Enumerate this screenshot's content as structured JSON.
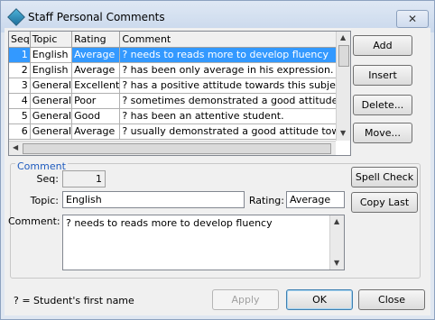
{
  "window": {
    "title": "Staff Personal Comments",
    "close_glyph": "✕"
  },
  "grid": {
    "columns": [
      "Seq",
      "Topic",
      "Rating",
      "Comment"
    ],
    "rows": [
      {
        "seq": "1",
        "topic": "English",
        "rating": "Average",
        "comment": "? needs to reads more to develop fluency"
      },
      {
        "seq": "2",
        "topic": "English",
        "rating": "Average",
        "comment": "? has been only average in his expression."
      },
      {
        "seq": "3",
        "topic": "General",
        "rating": "Excellent",
        "comment": "? has a positive attitude towards this subject."
      },
      {
        "seq": "4",
        "topic": "General",
        "rating": "Poor",
        "comment": "? sometimes demonstrated a good attitude."
      },
      {
        "seq": "5",
        "topic": "General",
        "rating": "Good",
        "comment": "? has been an attentive student."
      },
      {
        "seq": "6",
        "topic": "General",
        "rating": "Average",
        "comment": "? usually demonstrated a good attitude towards thi"
      }
    ]
  },
  "buttons": {
    "add": "Add",
    "insert": "Insert",
    "delete": "Delete...",
    "move": "Move...",
    "spell_check": "Spell Check",
    "copy_last": "Copy Last",
    "apply": "Apply",
    "ok": "OK",
    "close": "Close"
  },
  "comment_group": {
    "legend": "Comment",
    "seq_label": "Seq:",
    "seq_value": "1",
    "topic_label": "Topic:",
    "topic_value": "English",
    "rating_label": "Rating:",
    "rating_value": "Average",
    "comment_label": "Comment:",
    "comment_value": "? needs to reads more to develop fluency"
  },
  "footnote": "? = Student's first name"
}
